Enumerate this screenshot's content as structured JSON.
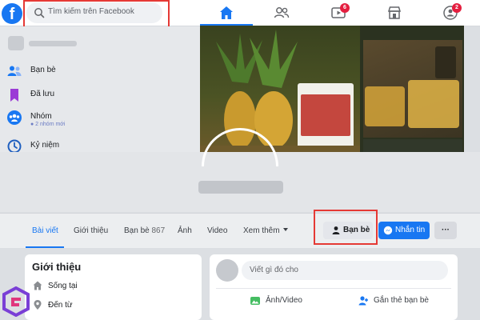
{
  "topbar": {
    "logo_letter": "f",
    "search_placeholder": "Tìm kiếm trên Facebook",
    "nav_icons": [
      "home-icon",
      "friends-icon",
      "watch-icon",
      "marketplace-icon",
      "groups-icon"
    ],
    "watch_badge": "6",
    "groups_badge": "2",
    "accent_color": "#1877f2",
    "badge_color": "#e41e3f",
    "highlight_color": "#e53935"
  },
  "sidebar": {
    "items": [
      {
        "label": "Bạn bè",
        "icon": "friends-icon"
      },
      {
        "label": "Đã lưu",
        "icon": "bookmark-icon"
      },
      {
        "label": "Nhóm",
        "icon": "groups-icon",
        "sub": "● 2 nhóm mới"
      },
      {
        "label": "Kỷ niệm",
        "icon": "clock-icon"
      }
    ]
  },
  "profile": {
    "tabs": [
      {
        "label": "Bài viết",
        "active": true
      },
      {
        "label": "Giới thiệu"
      },
      {
        "label": "Bạn bè",
        "count": "867"
      },
      {
        "label": "Ảnh"
      },
      {
        "label": "Video"
      },
      {
        "label": "Xem thêm",
        "dropdown": true
      }
    ],
    "friends_button": "Bạn bè",
    "message_button": "Nhắn tin",
    "more_button": "···"
  },
  "intro": {
    "title": "Giới thiệu",
    "rows": [
      {
        "label": "Sống tại",
        "icon": "home-icon"
      },
      {
        "label": "Đến từ",
        "icon": "location-pin-icon"
      }
    ]
  },
  "composer": {
    "placeholder": "Viết gì đó cho",
    "photo_label": "Ảnh/Video",
    "tag_label": "Gắn thẻ bạn bè"
  }
}
